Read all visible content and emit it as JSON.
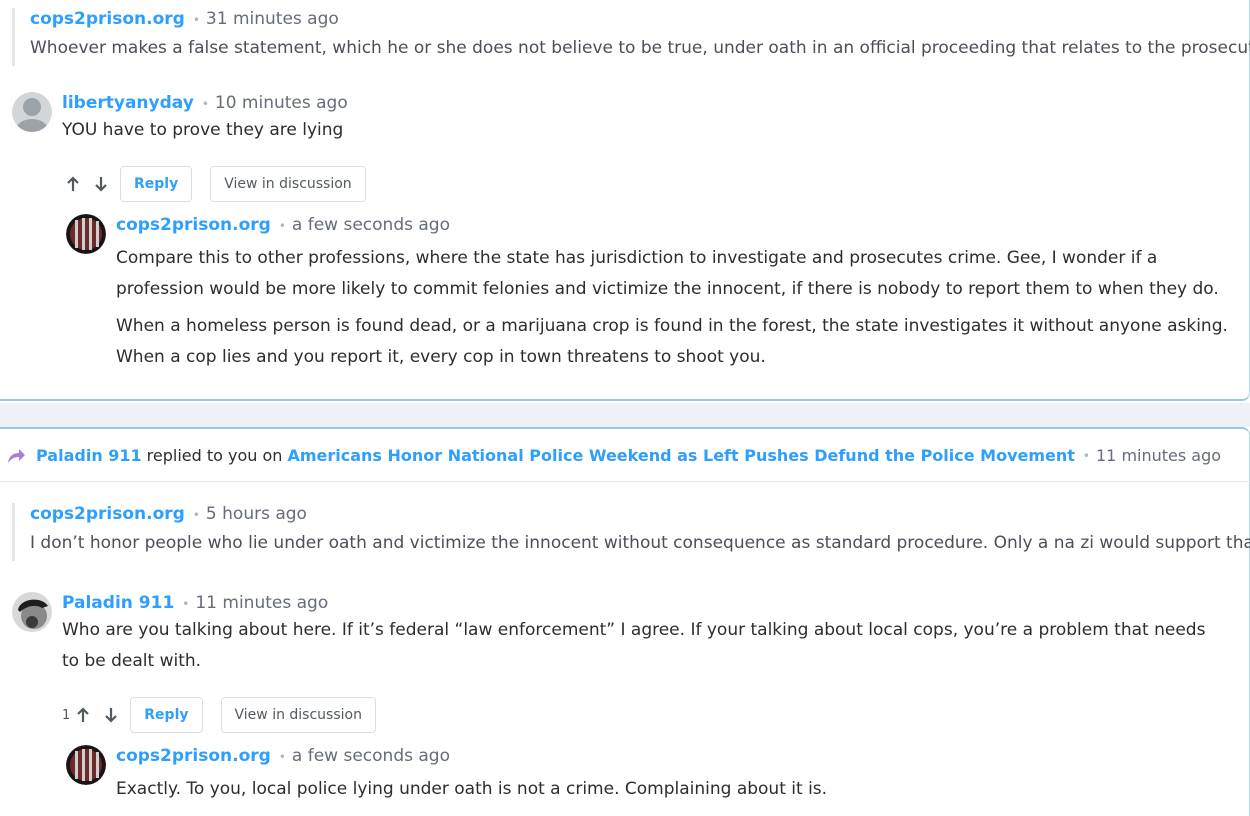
{
  "thread1": {
    "quote": {
      "author": "cops2prison.org",
      "time": "31 minutes ago",
      "text": "Whoever makes a false statement, which he or she does not believe to be true, under oath in an official proceeding that relates to the prosecuti..."
    },
    "comment": {
      "author": "libertyanyday",
      "time": "10 minutes ago",
      "text": "YOU have to prove they are lying",
      "reply_label": "Reply",
      "view_label": "View in discussion"
    },
    "reply": {
      "author": "cops2prison.org",
      "time": "a few seconds ago",
      "paragraphs": [
        "Compare this to other professions, where the state has jurisdiction to investigate and prosecutes crime. Gee, I wonder if a profession would be more likely to commit felonies and victimize the innocent, if there is nobody to report them to when they do.",
        "When a homeless person is found dead, or a marijuana crop is found in the forest, the state investigates it without anyone asking. When a cop lies and you report it, every cop in town threatens to shoot you."
      ]
    }
  },
  "notification": {
    "who": "Paladin 911",
    "text1": "replied to you on",
    "article": "Americans Honor National Police Weekend as Left Pushes Defund the Police Movement",
    "time": "11 minutes ago"
  },
  "thread2": {
    "quote": {
      "author": "cops2prison.org",
      "time": "5 hours ago",
      "text": "I don’t honor people who lie under oath and victimize the innocent without consequence as standard procedure. Only a na zi would support that."
    },
    "comment": {
      "author": "Paladin 911",
      "time": "11 minutes ago",
      "text": "Who are you talking about here. If it’s federal “law enforcement” I agree. If your talking about local cops, you’re a problem that needs to be dealt with.",
      "votes": "1",
      "reply_label": "Reply",
      "view_label": "View in discussion"
    },
    "reply": {
      "author": "cops2prison.org",
      "time": "a few seconds ago",
      "text": "Exactly. To you, local police lying under oath is not a crime. Complaining about it is."
    }
  },
  "separator": "•",
  "colors": {
    "accent": "#2e9fff",
    "share_icon": "#a77ed8"
  }
}
